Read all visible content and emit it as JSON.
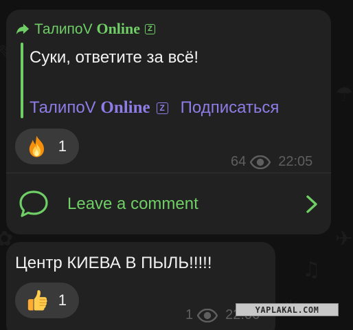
{
  "colors": {
    "background": "#111111",
    "bubble": "#212121",
    "accent_green": "#6fcf66",
    "accent_purple": "#8f7ce6",
    "text": "#f2f2f2",
    "meta": "#5f5f5f",
    "reaction_pill": "#3a3a3a"
  },
  "post": {
    "forwarded_from": {
      "icon": "forward-arrow-icon",
      "name_prefix": "ТалипоV",
      "name_suffix": "Online",
      "badge": "Z"
    },
    "quote_text": "Суки, ответите за всё!",
    "signature": {
      "name_prefix": "ТалипоV",
      "name_suffix": "Online",
      "badge": "Z",
      "subscribe_label": "Подписаться"
    },
    "reaction": {
      "emoji": "fire-emoji",
      "count": "1"
    },
    "views": "64",
    "views_icon": "eye-icon",
    "time": "22:05",
    "comment": {
      "icon": "comment-bubble-icon",
      "label": "Leave a comment",
      "chevron": "chevron-right-icon"
    }
  },
  "message2": {
    "text": "Центр КИЕВА В ПЫЛЬ!!!!!",
    "reaction": {
      "emoji": "thumbs-up-emoji",
      "count": "1"
    },
    "views": "1",
    "views_icon": "eye-icon",
    "time": "22:06"
  },
  "watermark": "YAPLAKAL.COM"
}
